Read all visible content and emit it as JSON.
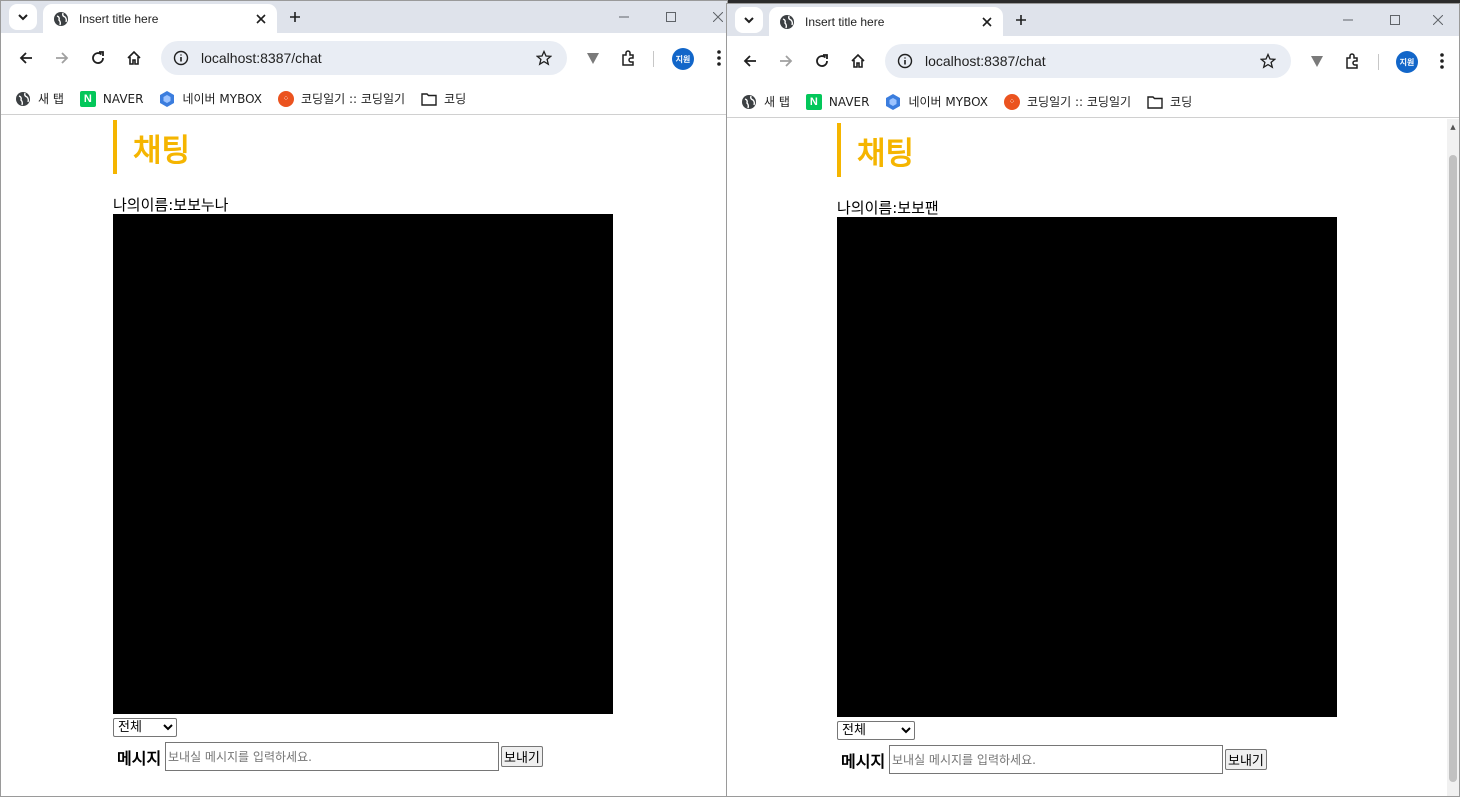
{
  "windows": [
    {
      "tab_title": "Insert title here",
      "url": "localhost:8387/chat",
      "profile_initials": "지원",
      "bookmarks": [
        "새 탭",
        "NAVER",
        "네이버 MYBOX",
        "코딩일기 :: 코딩일기",
        "코딩"
      ],
      "page": {
        "heading": "채팅",
        "name_label": "나의이름:",
        "name_value": "보보누나",
        "scope_selected": "전체",
        "message_label": "메시지",
        "message_placeholder": "보내실 메시지를 입력하세요.",
        "send_label": "보내기"
      }
    },
    {
      "tab_title": "Insert title here",
      "url": "localhost:8387/chat",
      "profile_initials": "지원",
      "bookmarks": [
        "새 탭",
        "NAVER",
        "네이버 MYBOX",
        "코딩일기 :: 코딩일기",
        "코딩"
      ],
      "page": {
        "heading": "채팅",
        "name_label": "나의이름:",
        "name_value": "보보팬",
        "scope_selected": "전체",
        "message_label": "메시지",
        "message_placeholder": "보내실 메시지를 입력하세요.",
        "send_label": "보내기"
      }
    }
  ],
  "colors": {
    "heading_accent": "#f5b500",
    "chat_area": "#000000",
    "tabstrip": "#dfe3eb",
    "omnibox": "#e9edf4",
    "avatar": "#1266c9"
  },
  "icons": [
    "tab-search-icon",
    "globe-icon",
    "close-icon",
    "plus-icon",
    "minimize-icon",
    "maximize-icon",
    "back-icon",
    "forward-icon",
    "reload-icon",
    "home-icon",
    "site-info-icon",
    "star-icon",
    "vivaldi-icon",
    "extensions-icon",
    "kebab-menu-icon",
    "naver-icon",
    "mybox-icon",
    "tistory-icon",
    "folder-icon"
  ]
}
